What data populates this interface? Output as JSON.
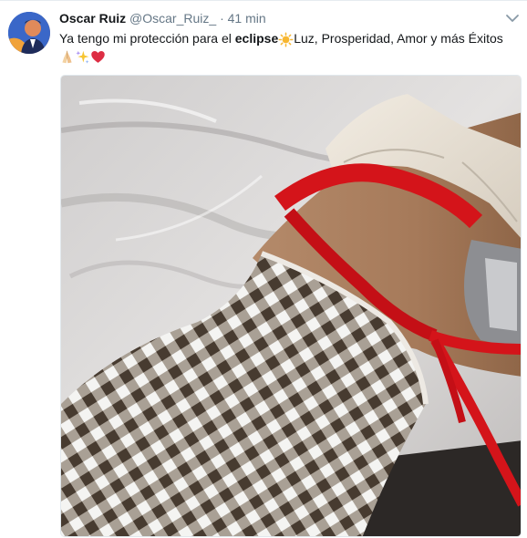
{
  "tweet": {
    "display_name": "Oscar Ruiz",
    "handle": "@Oscar_Ruiz_",
    "separator": "·",
    "time": "41 min",
    "text_before": "Ya tengo mi protección para el ",
    "text_bold": "eclipse",
    "text_after": "Luz, Prosperidad, Amor y más Éxitos",
    "emojis": [
      "sun-emoji",
      "folded-hands-emoji",
      "sparkles-emoji",
      "red-heart-emoji"
    ]
  },
  "colors": {
    "text": "#14171a",
    "muted": "#657786",
    "ribbon": "#d4141a",
    "border": "#e1e8ed"
  },
  "icons": {
    "menu": "chevron-down-icon"
  }
}
